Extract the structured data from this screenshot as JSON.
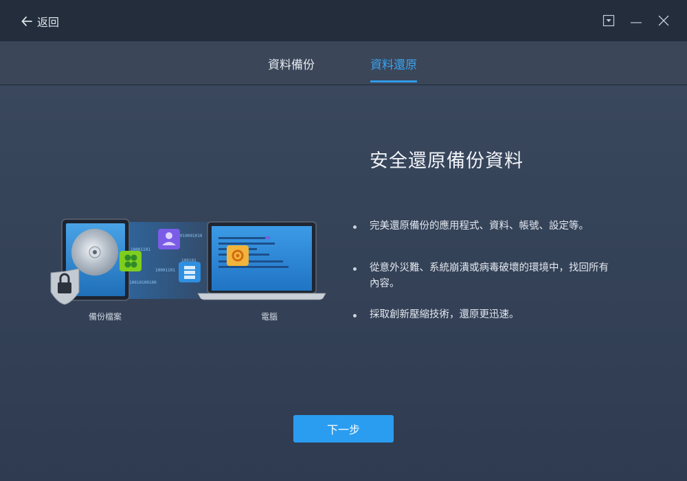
{
  "titlebar": {
    "back_label": "返回"
  },
  "tabs": [
    {
      "label": "資料備份",
      "active": false
    },
    {
      "label": "資料還原",
      "active": true
    }
  ],
  "main": {
    "headline": "安全還原備份資料",
    "bullets": [
      "完美還原備份的應用程式、資料、帳號、設定等。",
      "從意外災難、系統崩潰或病毒破壞的環境中，找回所有內容。",
      "採取創新壓縮技術，還原更迅速。"
    ],
    "illustration": {
      "left_caption": "備份檔案",
      "right_caption": "電腦",
      "binary_strings": [
        "010001010",
        "10001101",
        "100101",
        "10001101",
        "10010100100"
      ]
    }
  },
  "footer": {
    "next_label": "下一步"
  },
  "colors": {
    "accent": "#2a9df0",
    "titlebar_bg": "#232d3c",
    "body_bg": "#36445a"
  }
}
